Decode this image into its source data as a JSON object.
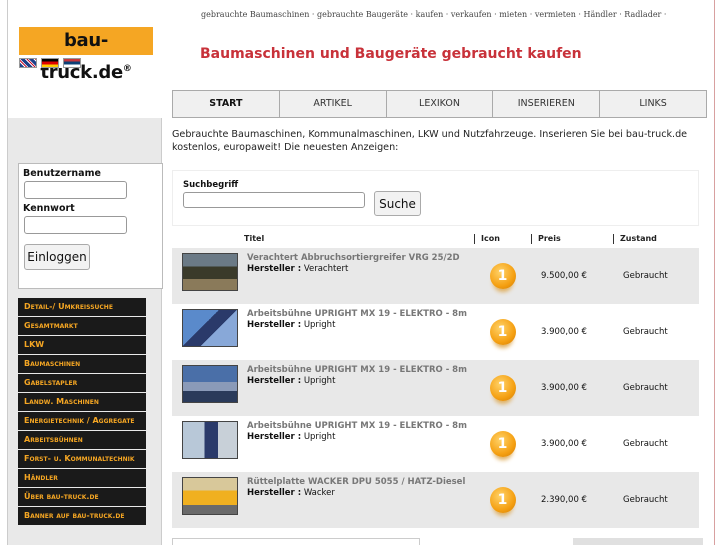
{
  "logo": {
    "text": "bau-truck.de",
    "mark": "®"
  },
  "flags": [
    "uk-flag-icon",
    "germany-flag-icon",
    "serbia-flag-icon"
  ],
  "topline": "gebrauchte Baumaschinen · gebrauchte Baugeräte · kaufen · verkaufen · mieten · vermieten · Händler · Radlader ·",
  "page_title": "Baumaschinen und Baugeräte gebraucht kaufen",
  "tabs": [
    "START",
    "ARTIKEL",
    "LEXIKON",
    "INSERIEREN",
    "LINKS"
  ],
  "intro": "Gebrauchte Baumaschinen, Kommunalmaschinen, LKW und Nutzfahrzeuge. Inserieren Sie bei bau-truck.de kostenlos, europaweit! Die neuesten Anzeigen:",
  "login": {
    "username_label": "Benutzername",
    "password_label": "Kennwort",
    "button": "Einloggen"
  },
  "nav": [
    "Detail-/ Umkreissuche",
    "Gesamtmarkt",
    "LKW",
    "Baumaschinen",
    "Gabelstapler",
    "Landw. Maschinen",
    "Energietechnik / Aggregate",
    "Arbeitsbühnen",
    "Forst- u. Kommunaltechnik",
    "Händler",
    "Über bau-truck.de",
    "Banner auf bau-truck.de"
  ],
  "search": {
    "label": "Suchbegriff",
    "button": "Suche",
    "value": ""
  },
  "table": {
    "headers": [
      "Titel",
      "Icon",
      "Preis",
      "Zustand"
    ],
    "maker_label": "Hersteller :",
    "rows": [
      {
        "title": "Verachtert Abbruchsortiergreifer VRG 25/2D",
        "maker": "Verachtert",
        "icon": "1",
        "price": "9.500,00 €",
        "state": "Gebraucht"
      },
      {
        "title": "Arbeitsbühne UPRIGHT MX 19 - ELEKTRO - 8m",
        "maker": "Upright",
        "icon": "1",
        "price": "3.900,00 €",
        "state": "Gebraucht"
      },
      {
        "title": "Arbeitsbühne UPRIGHT MX 19 - ELEKTRO - 8m",
        "maker": "Upright",
        "icon": "1",
        "price": "3.900,00 €",
        "state": "Gebraucht"
      },
      {
        "title": "Arbeitsbühne UPRIGHT MX 19 - ELEKTRO - 8m",
        "maker": "Upright",
        "icon": "1",
        "price": "3.900,00 €",
        "state": "Gebraucht"
      },
      {
        "title": "Rüttelplatte WACKER DPU 5055 / HATZ-Diesel",
        "maker": "Wacker",
        "icon": "1",
        "price": "2.390,00 €",
        "state": "Gebraucht"
      }
    ]
  }
}
